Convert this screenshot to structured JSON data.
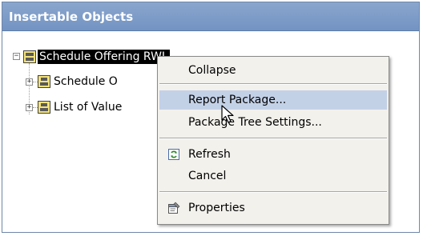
{
  "panel": {
    "title": "Insertable Objects"
  },
  "tree": {
    "root": {
      "label": "Schedule Offering RWL",
      "expander": "−"
    },
    "children": [
      {
        "label": "Schedule O",
        "expander": "+"
      },
      {
        "label": "List of Value",
        "expander": "+"
      }
    ]
  },
  "context_menu": {
    "items": [
      {
        "label": "Collapse",
        "icon": null
      },
      {
        "label": "Report Package...",
        "icon": null,
        "highlighted": true
      },
      {
        "label": "Package Tree Settings...",
        "icon": null
      },
      {
        "label": "Refresh",
        "icon": "refresh-icon"
      },
      {
        "label": "Cancel",
        "icon": null
      },
      {
        "label": "Properties",
        "icon": "properties-icon"
      }
    ]
  },
  "colors": {
    "header": "#7393c2",
    "menu_background": "#f3f1ec",
    "menu_highlight": "#c3d1e7",
    "selection": "#000000"
  }
}
